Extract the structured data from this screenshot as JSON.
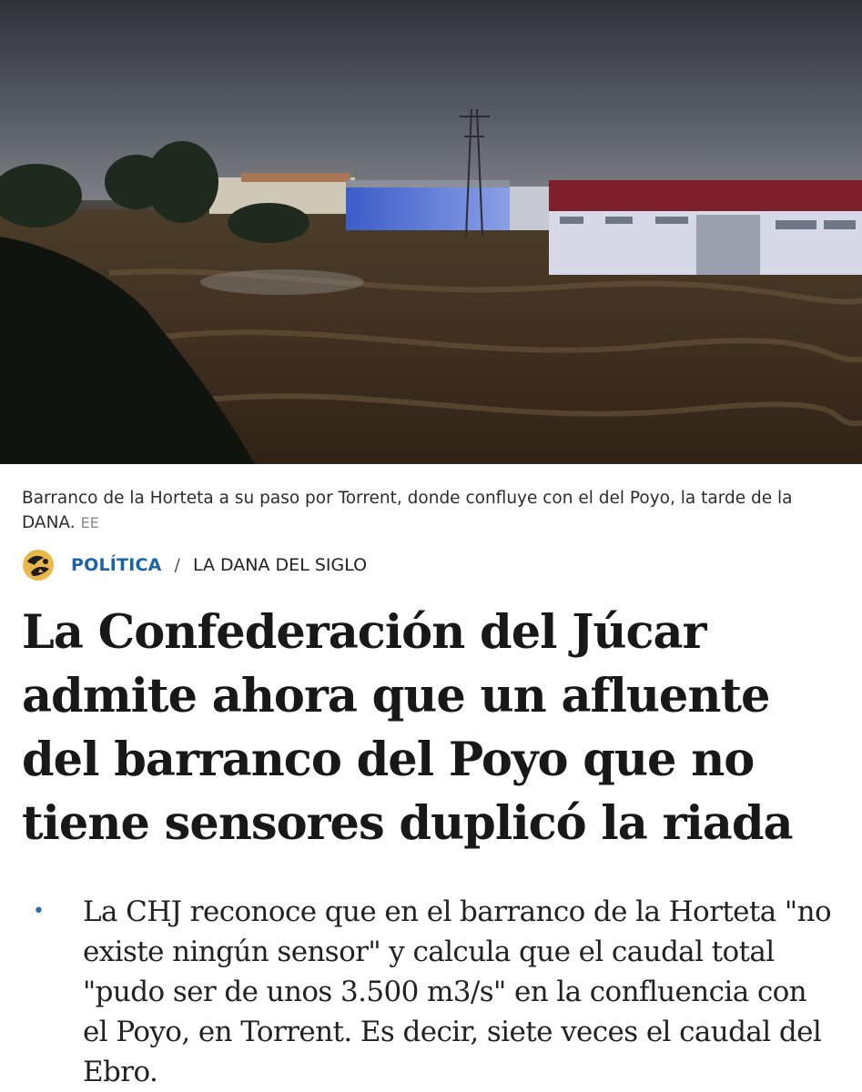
{
  "photo": {
    "alt": "Barranco de la Horteta a su paso por Torrent, donde confluye con el del Poyo, la tarde de la DANA."
  },
  "caption": {
    "text": "Barranco de la Horteta a su paso por Torrent, donde confluye con el del Poyo, la tarde de la DANA.",
    "credit": "EE"
  },
  "breadcrumb": {
    "section": "POLÍTICA",
    "separator": "/",
    "subsection": "LA DANA DEL SIGLO"
  },
  "headline": "La Confederación del Júcar admite ahora que un afluente del barranco del Poyo que no tiene sensores duplicó la riada",
  "summary": {
    "bullet": "•",
    "items": [
      "La CHJ reconoce que en el barranco de la Horteta \"no existe ningún sensor\" y calcula que el caudal total \"pudo ser de unos 3.500 m3/s\" en la confluencia con el Poyo, en Torrent. Es decir, siete veces el caudal del Ebro."
    ]
  },
  "colors": {
    "section_link": "#1b64a8",
    "bullet": "#2a6db0",
    "headline": "#181818",
    "credit": "#8a8a8a"
  },
  "icons": {
    "section_logo": "section-logo-icon"
  }
}
